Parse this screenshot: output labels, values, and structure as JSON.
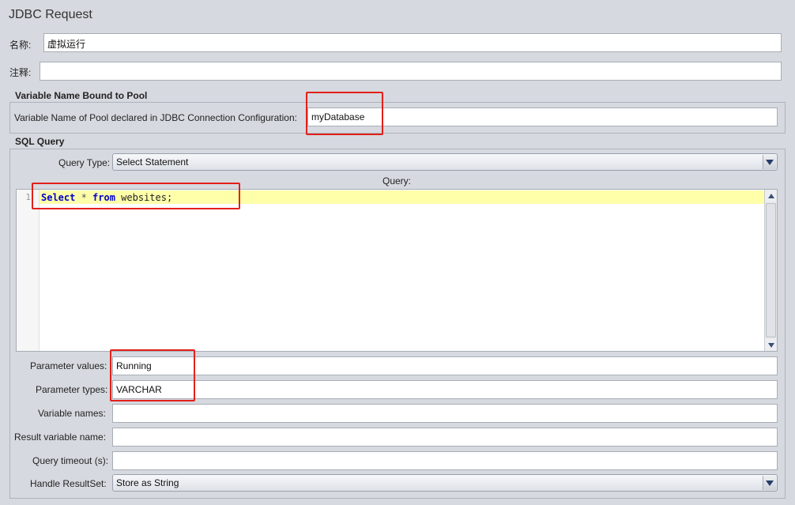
{
  "window": {
    "title": "JDBC Request"
  },
  "name_field": {
    "label": "名称:",
    "value": "虚拟运行"
  },
  "comment_field": {
    "label": "注释:",
    "value": ""
  },
  "pool_section": {
    "title": "Variable Name Bound to Pool",
    "pool_label": "Variable Name of Pool declared in JDBC Connection Configuration:",
    "pool_value": "myDatabase"
  },
  "sql_section": {
    "title": "SQL Query",
    "query_type_label": "Query Type:",
    "query_type_value": "Select Statement",
    "query_label": "Query:",
    "line_number": "1",
    "code_kw1": "Select",
    "code_op": " * ",
    "code_kw2": "from",
    "code_rest": " websites;"
  },
  "params": {
    "param_values_label": "Parameter values:",
    "param_values": "Running",
    "param_types_label": "Parameter types:",
    "param_types": "VARCHAR",
    "variable_names_label": "Variable names:",
    "variable_names": "",
    "result_variable_label": "Result variable name:",
    "result_variable": "",
    "query_timeout_label": "Query timeout (s):",
    "query_timeout": "",
    "handle_resultset_label": "Handle ResultSet:",
    "handle_resultset_value": "Store as String"
  },
  "colors": {
    "highlight_box": "#e3201b",
    "keyword": "#0000cc",
    "current_line": "#ffffaa"
  }
}
